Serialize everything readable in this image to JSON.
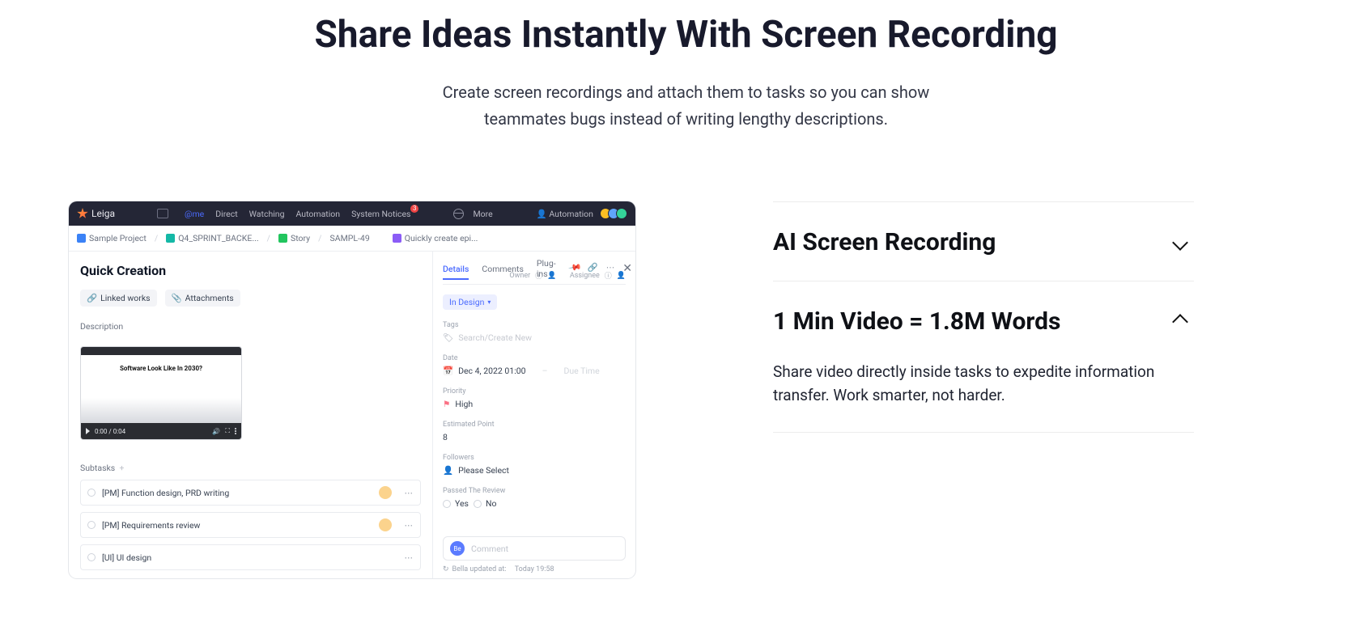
{
  "hero": {
    "title": "Share Ideas Instantly With Screen Recording",
    "subtitle": "Create screen recordings and attach them to tasks so you can show teammates bugs instead of writing lengthy descriptions."
  },
  "accordion": {
    "item1_title": "AI Screen Recording",
    "item2_title": "1 Min Video = 1.8M Words",
    "item2_body": "Share video directly inside tasks to expedite information transfer. Work smarter, not harder."
  },
  "app": {
    "brand": "Leiga",
    "topnav": {
      "atme": "@me",
      "direct": "Direct",
      "watching": "Watching",
      "automation": "Automation",
      "systemnotices": "System Notices",
      "notices_badge": "3",
      "more": "More",
      "right_automation": "Automation"
    },
    "breadcrumbs": {
      "c1": "Sample Project",
      "c2": "Q4_SPRINT_BACKE...",
      "c3": "Story",
      "c4": "SAMPL-49",
      "c5": "Quickly create epi..."
    },
    "left": {
      "title": "Quick Creation",
      "chip_linked": "Linked works",
      "chip_attach": "Attachments",
      "desc_label": "Description",
      "video_headline": "Software Look Like In 2030?",
      "video_time": "0:00 / 0:04",
      "subtasks_label": "Subtasks",
      "st1": "[PM] Function design, PRD writing",
      "st2": "[PM] Requirements review",
      "st3": "[UI] UI design"
    },
    "right": {
      "tab_details": "Details",
      "tab_comments": "Comments",
      "tab_plugins": "Plug-ins",
      "status": "In Design",
      "owner": "Owner",
      "assignee": "Assignee",
      "f_tags_label": "Tags",
      "f_tags_ph": "Search/Create New",
      "f_date_label": "Date",
      "f_date_val": "Dec 4, 2022 01:00",
      "f_date_due": "Due Time",
      "f_priority_label": "Priority",
      "f_priority_val": "High",
      "f_point_label": "Estimated Point",
      "f_point_val": "8",
      "f_followers_label": "Followers",
      "f_followers_ph": "Please Select",
      "f_review_label": "Passed The Review",
      "review_yes": "Yes",
      "review_no": "No",
      "comment_ph": "Comment",
      "updated_prefix": "Bella updated at:",
      "updated_time": "Today 19:58"
    }
  }
}
